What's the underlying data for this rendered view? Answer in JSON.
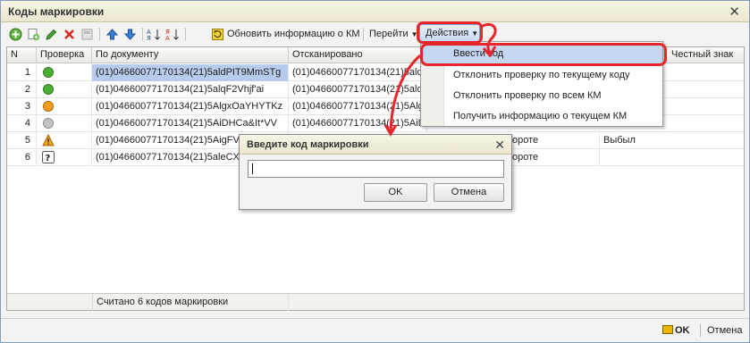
{
  "window": {
    "title": "Коды маркировки",
    "close_glyph": "✕"
  },
  "toolbar": {
    "refresh_label": "Обновить информацию о КМ",
    "go_label": "Перейти",
    "actions_label": "Действия"
  },
  "grid": {
    "columns": [
      "N",
      "Проверка",
      "По документу",
      "Отсканировано",
      "Честный знак"
    ],
    "rows": [
      {
        "n": "1",
        "status": "green",
        "doc": "(01)04660077170134(21)5aldPIT9MmSTg",
        "scan": "(01)04660077170134(21)5aldP",
        "extra": "",
        "selected": true
      },
      {
        "n": "2",
        "status": "green",
        "doc": "(01)04660077170134(21)5alqF2Vhjf'ai",
        "scan": "(01)04660077170134(21)5alqF",
        "extra": ""
      },
      {
        "n": "3",
        "status": "orange",
        "doc": "(01)04660077170134(21)5AlgxOaYHYTKz",
        "scan": "(01)04660077170134(21)5Algx",
        "extra": ""
      },
      {
        "n": "4",
        "status": "grey",
        "doc": "(01)04660077170134(21)5AiDHCa&It*VV",
        "scan": "(01)04660077170134(21)5AiDh",
        "extra": ""
      },
      {
        "n": "5",
        "status": "warning",
        "doc": "(01)04660077170134(21)5AigFV+",
        "scan": "",
        "check_text": "ороте",
        "extra": "Выбыл"
      },
      {
        "n": "6",
        "status": "question",
        "doc": "(01)04660077170134(21)5aleCXm",
        "scan": "",
        "check_text": "ороте",
        "extra": ""
      }
    ],
    "footer_text": "Считано 6 кодов маркировки"
  },
  "menu": {
    "items": [
      "Ввести код",
      "Отклонить проверку по текущему коду",
      "Отклонить проверку по всем КМ",
      "Получить информацию о текущем КМ"
    ]
  },
  "dialog": {
    "title": "Введите код маркировки",
    "input_value": "",
    "ok_label": "OK",
    "cancel_label": "Отмена",
    "close_glyph": "✕"
  },
  "bottom": {
    "ok_label": "OK",
    "cancel_label": "Отмена"
  },
  "colors": {
    "accent_red": "#e8252a",
    "selection": "#b7ccec",
    "status_green": "#4caf35",
    "status_orange": "#f29c1f",
    "status_grey": "#c4c4c4"
  }
}
